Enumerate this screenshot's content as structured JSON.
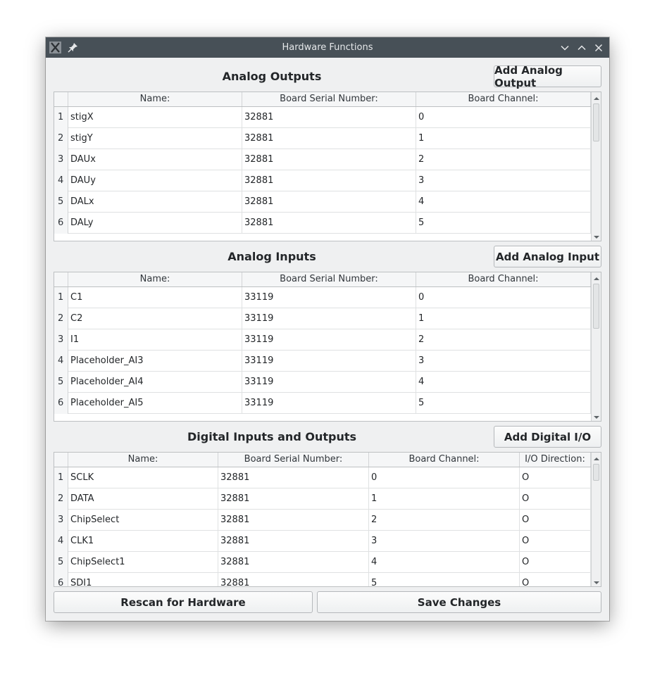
{
  "window": {
    "title": "Hardware Functions"
  },
  "analog_outputs": {
    "title": "Analog Outputs",
    "add_button": "Add Analog Output",
    "columns": [
      "Name:",
      "Board Serial Number:",
      "Board Channel:"
    ],
    "rows": [
      {
        "num": "1",
        "name": "stigX",
        "serial": "32881",
        "channel": "0"
      },
      {
        "num": "2",
        "name": "stigY",
        "serial": "32881",
        "channel": "1"
      },
      {
        "num": "3",
        "name": "DAUx",
        "serial": "32881",
        "channel": "2"
      },
      {
        "num": "4",
        "name": "DAUy",
        "serial": "32881",
        "channel": "3"
      },
      {
        "num": "5",
        "name": "DALx",
        "serial": "32881",
        "channel": "4"
      },
      {
        "num": "6",
        "name": "DALy",
        "serial": "32881",
        "channel": "5"
      }
    ]
  },
  "analog_inputs": {
    "title": "Analog Inputs",
    "add_button": "Add Analog Input",
    "columns": [
      "Name:",
      "Board Serial Number:",
      "Board Channel:"
    ],
    "rows": [
      {
        "num": "1",
        "name": "C1",
        "serial": "33119",
        "channel": "0"
      },
      {
        "num": "2",
        "name": "C2",
        "serial": "33119",
        "channel": "1"
      },
      {
        "num": "3",
        "name": "I1",
        "serial": "33119",
        "channel": "2"
      },
      {
        "num": "4",
        "name": "Placeholder_AI3",
        "serial": "33119",
        "channel": "3"
      },
      {
        "num": "5",
        "name": "Placeholder_AI4",
        "serial": "33119",
        "channel": "4"
      },
      {
        "num": "6",
        "name": "Placeholder_AI5",
        "serial": "33119",
        "channel": "5"
      }
    ]
  },
  "digital_io": {
    "title": "Digital Inputs and Outputs",
    "add_button": "Add Digital I/O",
    "columns": [
      "Name:",
      "Board Serial Number:",
      "Board Channel:",
      "I/O Direction:"
    ],
    "rows": [
      {
        "num": "1",
        "name": "SCLK",
        "serial": "32881",
        "channel": "0",
        "direction": "O"
      },
      {
        "num": "2",
        "name": "DATA",
        "serial": "32881",
        "channel": "1",
        "direction": "O"
      },
      {
        "num": "3",
        "name": "ChipSelect",
        "serial": "32881",
        "channel": "2",
        "direction": "O"
      },
      {
        "num": "4",
        "name": "CLK1",
        "serial": "32881",
        "channel": "3",
        "direction": "O"
      },
      {
        "num": "5",
        "name": "ChipSelect1",
        "serial": "32881",
        "channel": "4",
        "direction": "O"
      },
      {
        "num": "6",
        "name": "SDI1",
        "serial": "32881",
        "channel": "5",
        "direction": "O"
      }
    ]
  },
  "footer": {
    "rescan_button": "Rescan for Hardware",
    "save_button": "Save Changes"
  }
}
